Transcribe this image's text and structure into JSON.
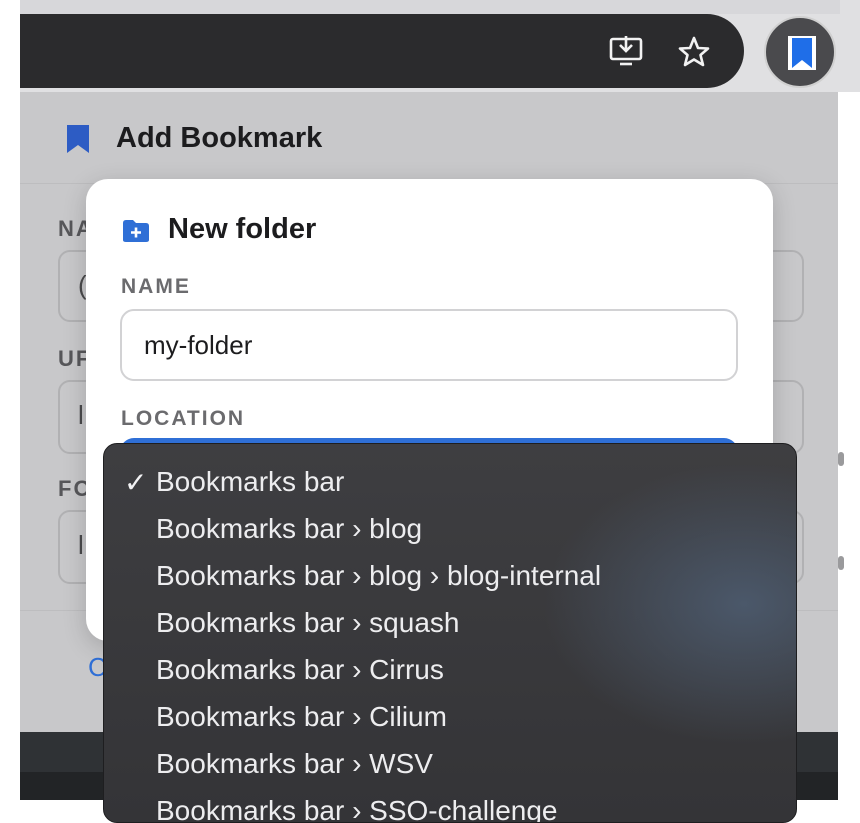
{
  "browser": {
    "toolbar_icons": [
      "install-app-icon",
      "star-icon",
      "bookmark-extension-icon"
    ]
  },
  "popup": {
    "title": "Add Bookmark",
    "bg_fields": {
      "name_label_partial": "NA",
      "url_label_partial": "UF",
      "folder_label_partial": "FO",
      "name_value_partial": "(",
      "url_value_partial": "l",
      "folder_value_partial": "l",
      "footer_partial": "C"
    }
  },
  "modal": {
    "title": "New folder",
    "name_label": "NAME",
    "name_value": "my-folder",
    "location_label": "LOCATION"
  },
  "dropdown": {
    "selected_index": 0,
    "check_mark": "✓",
    "options": [
      "Bookmarks bar",
      "Bookmarks bar › blog",
      "Bookmarks bar › blog › blog-internal",
      "Bookmarks bar › squash",
      "Bookmarks bar › Cirrus",
      "Bookmarks bar › Cilium",
      "Bookmarks bar › WSV",
      "Bookmarks bar › SSO-challenge"
    ]
  },
  "colors": {
    "accent_blue": "#2f6fd6",
    "dropdown_bg": "#3a3a3d",
    "popup_dim": "#c8c8ca"
  }
}
